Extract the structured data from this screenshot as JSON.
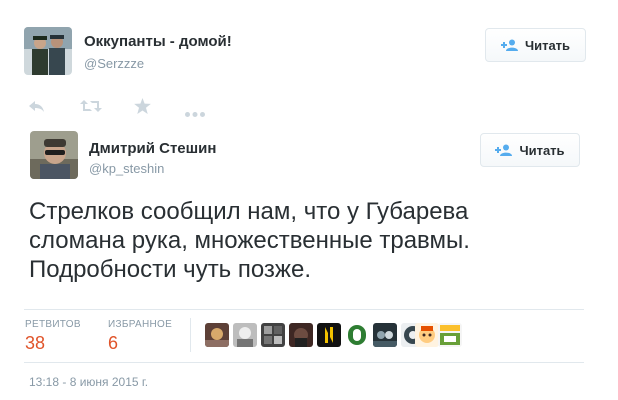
{
  "quoted_tweet": {
    "author_name": "Оккупанты - домой!",
    "handle": "@Serzzze",
    "follow_label": "Читать",
    "actions": [
      "reply-icon",
      "retweet-icon",
      "favorite-icon",
      "more-icon"
    ]
  },
  "main_tweet": {
    "author_name": "Дмитрий Стешин",
    "handle": "@kp_steshin",
    "follow_label": "Читать",
    "text_lines": [
      "Стрелков сообщил нам, что у Губарева",
      "сломана рука, множественные травмы.",
      "Подробности чуть позже."
    ],
    "stats": {
      "retweets_label": "РЕТВИТОВ",
      "retweets_count": "38",
      "favorites_label": "ИЗБРАННОЕ",
      "favorites_count": "6"
    },
    "timestamp": "13:18 - 8 июня 2015 г."
  },
  "colors": {
    "accent_count": "#e0542a",
    "text_primary": "#292f33",
    "text_muted": "#8899a6",
    "follow_icon": "#55acee"
  }
}
